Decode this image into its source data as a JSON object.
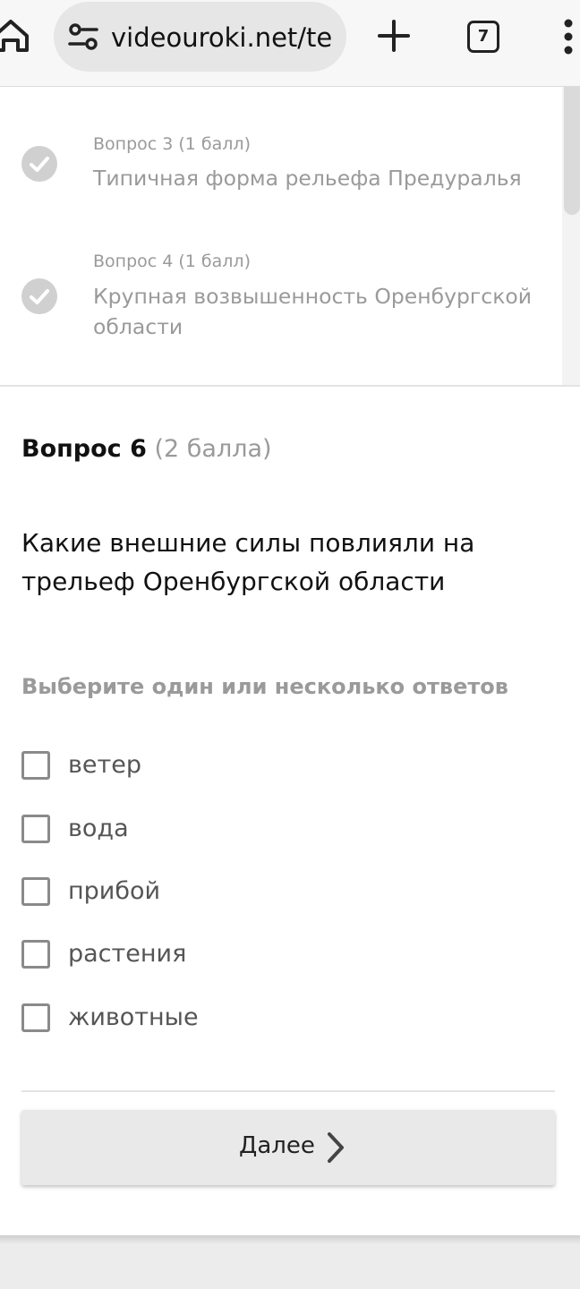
{
  "browser": {
    "url": "videouroki.net/tes",
    "tab_count": "7",
    "icons": [
      "home-icon",
      "site-settings-icon",
      "new-tab-plus-icon",
      "tab-switcher-icon",
      "more-menu-icon"
    ]
  },
  "answered_questions": [
    {
      "meta": "Вопрос 3 (1 балл)",
      "title": "Типичная форма рельефа Предуралья",
      "status": "answered"
    },
    {
      "meta": "Вопрос 4 (1 балл)",
      "title": "Крупная возвышенность Оренбургской области",
      "status": "answered"
    }
  ],
  "current_question": {
    "number_label": "Вопрос 6",
    "points_label": "(2 балла)",
    "text": "Какие внешние силы повлияли на трельеф Оренбургской области",
    "instruction": "Выберите один или несколько ответов",
    "options": [
      {
        "label": "ветер",
        "checked": false
      },
      {
        "label": "вода",
        "checked": false
      },
      {
        "label": "прибой",
        "checked": false
      },
      {
        "label": "растения",
        "checked": false
      },
      {
        "label": "животные",
        "checked": false
      }
    ]
  },
  "next_button": {
    "label": "Далее"
  },
  "colors": {
    "toolbar_bg": "#f7f7f7",
    "url_pill_bg": "#e6e6e6",
    "muted_text": "#9a9a9a",
    "check_circle": "#d0d0d0",
    "button_bg": "#e9e9e9"
  }
}
